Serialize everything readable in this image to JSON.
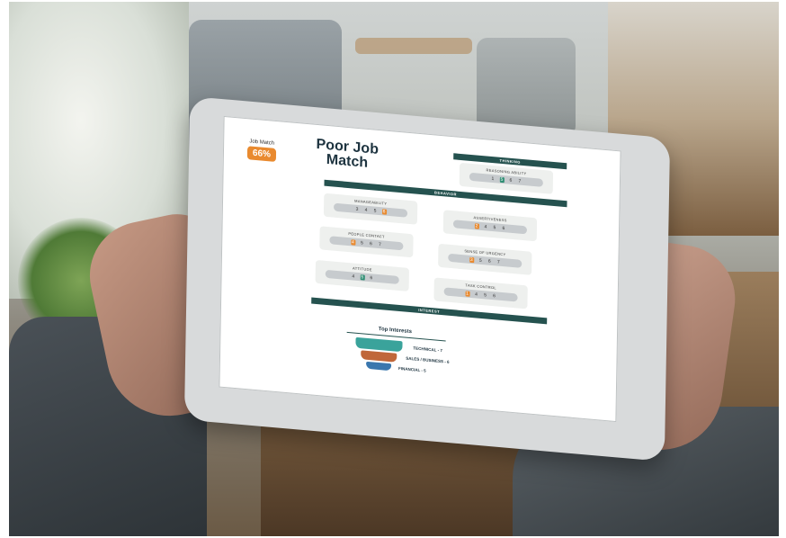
{
  "screen": {
    "match_label": "Job Match",
    "match_percent": "66%",
    "title_line1": "Poor Job",
    "title_line2": "Match",
    "sections": {
      "thinking": "THINKING",
      "behavior": "BEHAVIOR",
      "interests": "INTEREST"
    },
    "thinking_items": [
      {
        "label": "REASONING ABILITY",
        "values": [
          "1",
          "5",
          "6",
          "7",
          "8"
        ]
      }
    ],
    "behavior_items": [
      {
        "label": "MANAGEABILITY",
        "values": [
          "3",
          "4",
          "5",
          "6",
          "7"
        ]
      },
      {
        "label": "ASSERTIVENESS",
        "values": [
          "2",
          "3",
          "4",
          "5",
          "6"
        ]
      },
      {
        "label": "PEOPLE CONTACT",
        "values": [
          "4",
          "5",
          "6",
          "7",
          "8"
        ]
      },
      {
        "label": "SENSE OF URGENCY",
        "values": [
          "3",
          "4",
          "5",
          "6",
          "7"
        ]
      },
      {
        "label": "ATTITUDE",
        "values": [
          "3",
          "4",
          "5",
          "6",
          "7"
        ]
      },
      {
        "label": "TASK CONTROL",
        "values": [
          "1",
          "4",
          "5",
          "6",
          "7"
        ]
      }
    ],
    "top_interests_title": "Top Interests",
    "interests": [
      "TECHNICAL - 7",
      "SALES / BUSINESS - 6",
      "FINANCIAL - 5"
    ],
    "colors": {
      "accent_orange": "#e98a2f",
      "accent_green": "#2f8e73",
      "band": "#25524f",
      "funnel_teal": "#3aa39b",
      "funnel_rust": "#c0673a",
      "funnel_blue": "#3a77ae"
    }
  }
}
